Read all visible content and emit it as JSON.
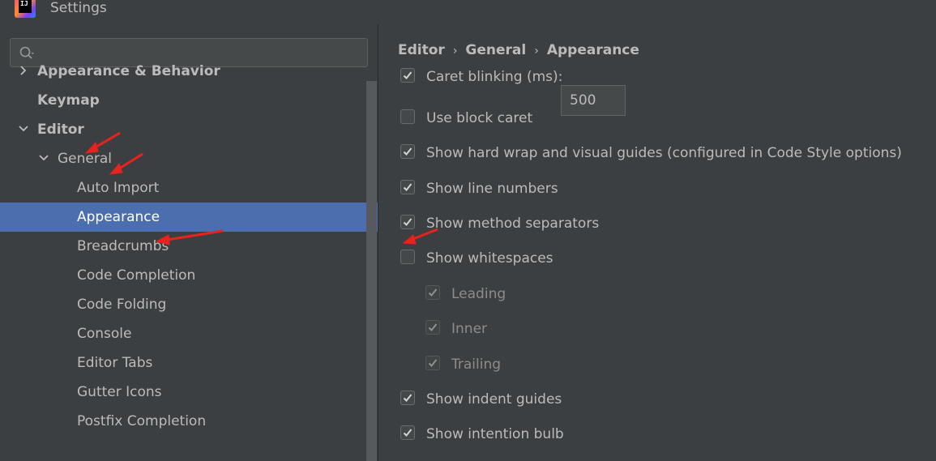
{
  "window": {
    "title": "Settings",
    "logo_text": "IJ"
  },
  "search": {
    "value": "",
    "placeholder": ""
  },
  "tree": [
    {
      "label": "Appearance & Behavior",
      "bold": true,
      "expanded": false,
      "chevron": "chevron-right-icon"
    },
    {
      "label": "Keymap",
      "bold": true
    },
    {
      "label": "Editor",
      "bold": true,
      "expanded": true,
      "chevron": "chevron-down-icon"
    },
    {
      "label": "General",
      "expanded": true,
      "chevron": "chevron-down-icon"
    },
    {
      "label": "Auto Import"
    },
    {
      "label": "Appearance",
      "selected": true
    },
    {
      "label": "Breadcrumbs"
    },
    {
      "label": "Code Completion"
    },
    {
      "label": "Code Folding"
    },
    {
      "label": "Console"
    },
    {
      "label": "Editor Tabs"
    },
    {
      "label": "Gutter Icons"
    },
    {
      "label": "Postfix Completion"
    }
  ],
  "breadcrumb": [
    "Editor",
    "General",
    "Appearance"
  ],
  "options": {
    "caret_blinking": {
      "label": "Caret blinking (ms):",
      "checked": true,
      "value": "500"
    },
    "block_caret": {
      "label": "Use block caret",
      "checked": false
    },
    "hard_wrap": {
      "label": "Show hard wrap and visual guides (configured in Code Style options)",
      "checked": true
    },
    "line_numbers": {
      "label": "Show line numbers",
      "checked": true
    },
    "method_separators": {
      "label": "Show method separators",
      "checked": true
    },
    "whitespaces": {
      "label": "Show whitespaces",
      "checked": false
    },
    "leading": {
      "label": "Leading",
      "checked": true,
      "disabled": true
    },
    "inner": {
      "label": "Inner",
      "checked": true,
      "disabled": true
    },
    "trailing": {
      "label": "Trailing",
      "checked": true,
      "disabled": true
    },
    "indent_guides": {
      "label": "Show indent guides",
      "checked": true
    },
    "intention_bulb": {
      "label": "Show intention bulb",
      "checked": true
    }
  },
  "colors": {
    "background": "#3c3f41",
    "selection": "#4b6eaf",
    "annotation_arrow": "#e8221c"
  }
}
